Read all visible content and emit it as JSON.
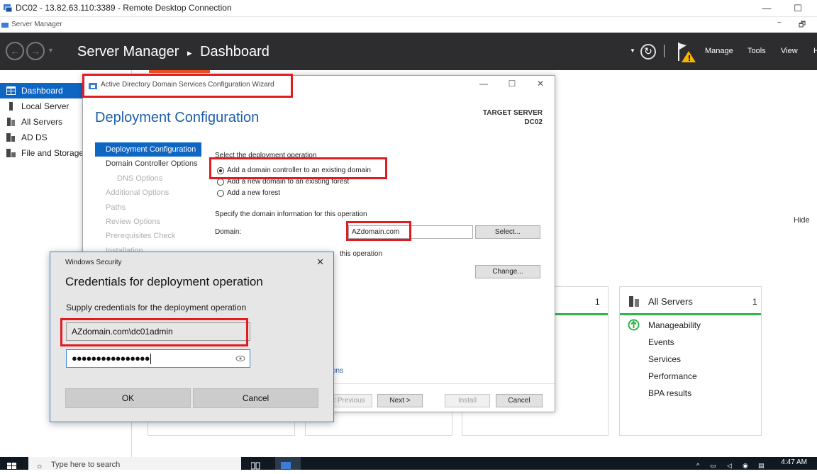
{
  "rdp": {
    "title": "DC02 - 13.82.63.110:3389 - Remote Desktop Connection",
    "minimize": "—",
    "maximize": "☐",
    "close": "✕"
  },
  "sm_window": {
    "title": "Server Manager",
    "minimize": "−",
    "restore": "🗗"
  },
  "header": {
    "app": "Server Manager",
    "separator": "▸",
    "page": "Dashboard",
    "menus": [
      "Manage",
      "Tools",
      "View",
      "H"
    ]
  },
  "nav": {
    "items": [
      {
        "label": "Dashboard"
      },
      {
        "label": "Local Server"
      },
      {
        "label": "All Servers"
      },
      {
        "label": "AD DS"
      },
      {
        "label": "File and Storage"
      }
    ]
  },
  "dashboard": {
    "hide": "Hide",
    "tile_count": "1",
    "all_servers": {
      "title": "All Servers",
      "count": "1",
      "items": [
        "Manageability",
        "Events",
        "Services",
        "Performance",
        "BPA results"
      ]
    }
  },
  "wizard": {
    "title": "Active Directory Domain Services Configuration Wizard",
    "heading": "Deployment Configuration",
    "target_server_label": "TARGET SERVER",
    "target_server": "DC02",
    "steps": [
      {
        "label": "Deployment Configuration",
        "state": "current"
      },
      {
        "label": "Domain Controller Options",
        "state": "enabled"
      },
      {
        "label": "DNS Options",
        "state": "disabled"
      },
      {
        "label": "Additional Options",
        "state": "disabled"
      },
      {
        "label": "Paths",
        "state": "disabled"
      },
      {
        "label": "Review Options",
        "state": "disabled"
      },
      {
        "label": "Prerequisites Check",
        "state": "disabled"
      },
      {
        "label": "Installation",
        "state": "disabled"
      }
    ],
    "select_op_label": "Select the deployment operation",
    "options": [
      {
        "label": "Add a domain controller to an existing domain",
        "selected": true
      },
      {
        "label": "Add a new domain to an existing forest",
        "selected": false
      },
      {
        "label": "Add a new forest",
        "selected": false
      }
    ],
    "domain_info_label": "Specify the domain information for this operation",
    "domain_label": "Domain:",
    "domain_value": "AZdomain.com",
    "select_button": "Select...",
    "credentials_label_tail": "this operation",
    "change_button": "Change...",
    "more_link_tail": "ons",
    "buttons": {
      "previous": "< Previous",
      "next": "Next >",
      "install": "Install",
      "cancel": "Cancel"
    }
  },
  "credentials": {
    "window_title": "Windows Security",
    "heading": "Credentials for deployment operation",
    "subtitle": "Supply credentials for the deployment operation",
    "username": "AZdomain.com\\dc01admin",
    "password_mask": "●●●●●●●●●●●●●●●●",
    "ok": "OK",
    "cancel": "Cancel"
  },
  "taskbar": {
    "search_placeholder": "Type here to search",
    "time": "4:47 AM"
  },
  "colors": {
    "accent": "#0e66c2",
    "highlight": "#e11b22",
    "header_bg": "#2d2d30",
    "status_green": "#32b24a"
  }
}
